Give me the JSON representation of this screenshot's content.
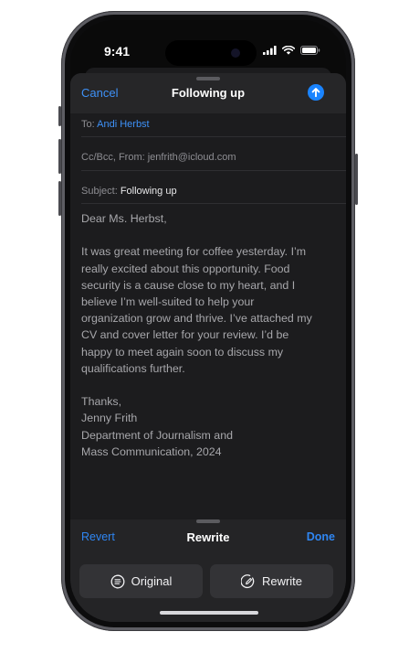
{
  "status_bar": {
    "time": "9:41"
  },
  "compose": {
    "cancel_label": "Cancel",
    "title": "Following up",
    "to_label": "To:",
    "to_value": "Andi Herbst",
    "cc_label": "Cc/Bcc, From:",
    "cc_value": "jenfrith@icloud.com",
    "subject_label": "Subject:",
    "subject_value": "Following up",
    "greeting": "Dear Ms. Herbst,",
    "body_lines": [
      "It was great meeting for coffee yesterday. I’m",
      "really excited about this opportunity. Food",
      "security is a cause close to my heart, and I",
      "believe I’m well-suited to help your",
      "organization grow and thrive. I’ve attached my",
      "CV and cover letter for your review. I’d be",
      "happy to meet again soon to discuss my",
      "qualifications further."
    ],
    "signature_lines": [
      "Thanks,",
      "Jenny Frith",
      "Department of Journalism and",
      "Mass Communication, 2024"
    ]
  },
  "rewrite_panel": {
    "revert_label": "Revert",
    "title": "Rewrite",
    "done_label": "Done",
    "original_label": "Original",
    "rewrite_label": "Rewrite"
  },
  "colors": {
    "accent": "#3e91f7",
    "send_button": "#1a84ff",
    "sheet_bg": "#1c1c1e"
  },
  "icons": {
    "status": [
      "cellular-signal-icon",
      "wifi-icon",
      "battery-icon"
    ],
    "send": "arrow-up-circle-icon",
    "original": "document-lines-circle-icon",
    "rewrite": "rewrite-circle-icon"
  }
}
